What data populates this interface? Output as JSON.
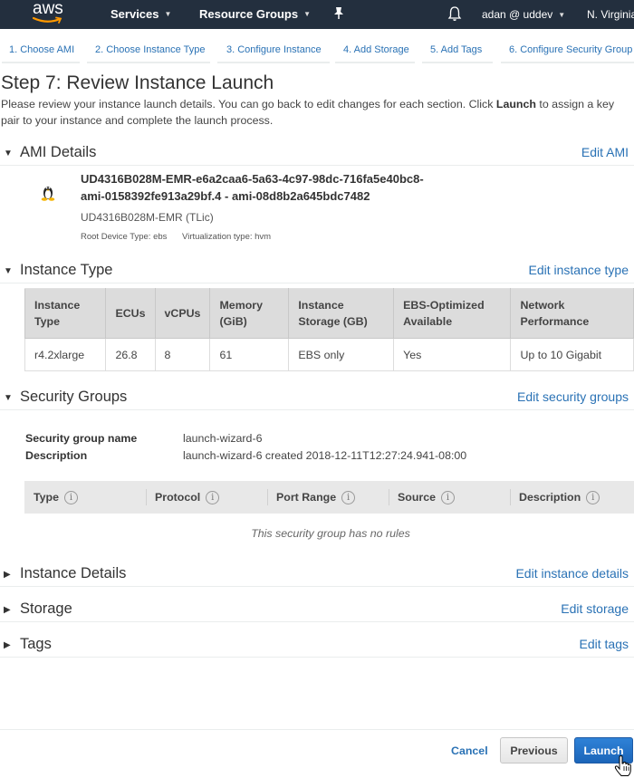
{
  "topnav": {
    "logo": "aws",
    "services": "Services",
    "resource_groups": "Resource Groups",
    "pin_icon": "pin-icon",
    "bell_icon": "bell-icon",
    "user": "adan @ uddev",
    "region": "N. Virginia"
  },
  "steps": [
    {
      "label": "1. Choose AMI"
    },
    {
      "label": "2. Choose Instance Type"
    },
    {
      "label": "3. Configure Instance"
    },
    {
      "label": "4. Add Storage"
    },
    {
      "label": "5. Add Tags"
    },
    {
      "label": "6. Configure Security Group"
    }
  ],
  "page": {
    "title": "Step 7: Review Instance Launch",
    "intro_before": "Please review your instance launch details. You can go back to edit changes for each section. Click ",
    "intro_bold": "Launch",
    "intro_after": " to assign a key pair to your instance and complete the launch process."
  },
  "sections": {
    "ami": {
      "title": "AMI Details",
      "edit": "Edit AMI",
      "icon": "linux-penguin-icon",
      "name_line1": "UD4316B028M-EMR-e6a2caa6-5a63-4c97-98dc-716fa5e40bc8-",
      "name_line2": "ami-0158392fe913a29bf.4 - ami-08d8b2a645bdc7482",
      "description": "UD4316B028M-EMR (TLic)",
      "root_device": "Root Device Type: ebs",
      "virtualization": "Virtualization type: hvm"
    },
    "instance_type": {
      "title": "Instance Type",
      "edit": "Edit instance type",
      "columns": [
        {
          "line1": "Instance",
          "line2": "Type"
        },
        {
          "line1": "ECUs",
          "line2": ""
        },
        {
          "line1": "vCPUs",
          "line2": ""
        },
        {
          "line1": "Memory",
          "line2": "(GiB)"
        },
        {
          "line1": "Instance",
          "line2": "Storage (GB)"
        },
        {
          "line1": "EBS-Optimized",
          "line2": "Available"
        },
        {
          "line1": "Network",
          "line2": "Performance"
        }
      ],
      "row": [
        "r4.2xlarge",
        "26.8",
        "8",
        "61",
        "EBS only",
        "Yes",
        "Up to 10 Gigabit"
      ]
    },
    "security_groups": {
      "title": "Security Groups",
      "edit": "Edit security groups",
      "name_label": "Security group name",
      "name_value": "launch-wizard-6",
      "desc_label": "Description",
      "desc_value": "launch-wizard-6 created 2018-12-11T12:27:24.941-08:00",
      "rule_columns": [
        "Type",
        "Protocol",
        "Port Range",
        "Source",
        "Description"
      ],
      "empty_message": "This security group has no rules"
    },
    "instance_details": {
      "title": "Instance Details",
      "edit": "Edit instance details"
    },
    "storage": {
      "title": "Storage",
      "edit": "Edit storage"
    },
    "tags": {
      "title": "Tags",
      "edit": "Edit tags"
    }
  },
  "footer": {
    "cancel": "Cancel",
    "previous": "Previous",
    "launch": "Launch"
  },
  "colors": {
    "nav_bg": "#232f3e",
    "link": "#2a72b5",
    "primary_button": "#1b65b9",
    "aws_orange": "#ff9900"
  }
}
